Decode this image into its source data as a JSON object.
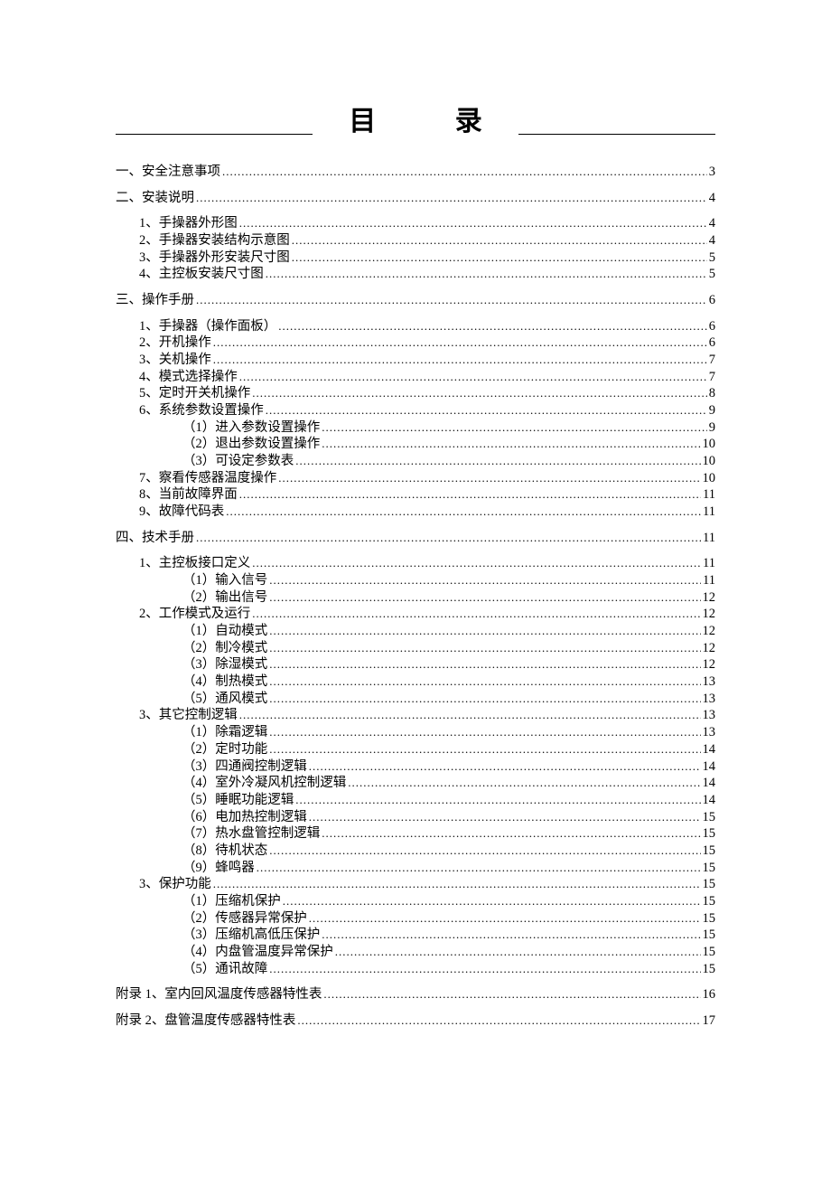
{
  "title": "目 录",
  "toc": [
    {
      "indent": 0,
      "label": "一、安全注意事项",
      "page": "3",
      "gap_before": true
    },
    {
      "indent": 0,
      "label": "二、安装说明",
      "page": "4",
      "gap_before": true
    },
    {
      "indent": 1,
      "label": "1、手操器外形图",
      "page": "4",
      "gap_before": true
    },
    {
      "indent": 1,
      "label": "2、手操器安装结构示意图",
      "page": "4"
    },
    {
      "indent": 1,
      "label": "3、手操器外形安装尺寸图",
      "page": "5"
    },
    {
      "indent": 1,
      "label": "4、主控板安装尺寸图",
      "page": "5"
    },
    {
      "indent": 0,
      "label": "三、操作手册",
      "page": "6",
      "gap_before": true
    },
    {
      "indent": 1,
      "label": "1、手操器（操作面板）",
      "page": "6",
      "gap_before": true
    },
    {
      "indent": 1,
      "label": "2、开机操作",
      "page": "6"
    },
    {
      "indent": 1,
      "label": "3、关机操作",
      "page": "7"
    },
    {
      "indent": 1,
      "label": "4、模式选择操作",
      "page": "7"
    },
    {
      "indent": 1,
      "label": "5、定时开关机操作",
      "page": "8"
    },
    {
      "indent": 1,
      "label": "6、系统参数设置操作",
      "page": "9"
    },
    {
      "indent": 2,
      "label": "（1）进入参数设置操作",
      "page": "9"
    },
    {
      "indent": 2,
      "label": "（2）退出参数设置操作",
      "page": "10"
    },
    {
      "indent": 2,
      "label": "（3）可设定参数表",
      "page": "10"
    },
    {
      "indent": 1,
      "label": "7、察看传感器温度操作",
      "page": "10"
    },
    {
      "indent": 1,
      "label": "8、当前故障界面",
      "page": "11"
    },
    {
      "indent": 1,
      "label": "9、故障代码表",
      "page": "11"
    },
    {
      "indent": 0,
      "label": "四、技术手册",
      "page": "11",
      "gap_before": true
    },
    {
      "indent": 1,
      "label": "1、主控板接口定义",
      "page": "11",
      "gap_before": true
    },
    {
      "indent": 2,
      "label": "（1）输入信号",
      "page": "11"
    },
    {
      "indent": 2,
      "label": "（2）输出信号",
      "page": "12"
    },
    {
      "indent": 1,
      "label": "2、工作模式及运行",
      "page": "12"
    },
    {
      "indent": 2,
      "label": "（1）自动模式",
      "page": "12"
    },
    {
      "indent": 2,
      "label": "（2）制冷模式",
      "page": "12"
    },
    {
      "indent": 2,
      "label": "（3）除湿模式",
      "page": "12"
    },
    {
      "indent": 2,
      "label": "（4）制热模式",
      "page": "13"
    },
    {
      "indent": 2,
      "label": "（5）通风模式",
      "page": "13"
    },
    {
      "indent": 1,
      "label": "3、其它控制逻辑",
      "page": "13"
    },
    {
      "indent": 2,
      "label": "（1）除霜逻辑",
      "page": "13"
    },
    {
      "indent": 2,
      "label": "（2）定时功能",
      "page": "14"
    },
    {
      "indent": 2,
      "label": "（3）四通阀控制逻辑",
      "page": "14"
    },
    {
      "indent": 2,
      "label": "（4）室外冷凝风机控制逻辑",
      "page": "14"
    },
    {
      "indent": 2,
      "label": "（5）睡眠功能逻辑",
      "page": "14"
    },
    {
      "indent": 2,
      "label": "（6）电加热控制逻辑",
      "page": "15"
    },
    {
      "indent": 2,
      "label": "（7）热水盘管控制逻辑",
      "page": "15"
    },
    {
      "indent": 2,
      "label": "（8）待机状态",
      "page": "15"
    },
    {
      "indent": 2,
      "label": "（9）蜂鸣器",
      "page": "15"
    },
    {
      "indent": 1,
      "label": "3、保护功能",
      "page": "15"
    },
    {
      "indent": 2,
      "label": "（1）压缩机保护",
      "page": "15"
    },
    {
      "indent": 2,
      "label": "（2）传感器异常保护",
      "page": "15"
    },
    {
      "indent": 2,
      "label": "（3）压缩机高低压保护",
      "page": "15"
    },
    {
      "indent": 2,
      "label": "（4）内盘管温度异常保护",
      "page": "15"
    },
    {
      "indent": 2,
      "label": "（5）通讯故障",
      "page": "15"
    },
    {
      "indent": 0,
      "label": "附录 1、室内回风温度传感器特性表",
      "page": "16",
      "gap_before": true
    },
    {
      "indent": 0,
      "label": "附录 2、盘管温度传感器特性表",
      "page": "17",
      "gap_before": true
    }
  ]
}
